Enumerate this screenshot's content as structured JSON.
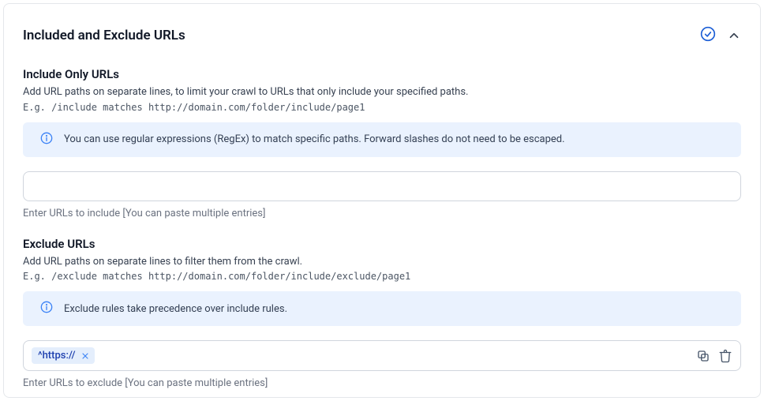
{
  "panel": {
    "title": "Included and Exclude URLs"
  },
  "include": {
    "title": "Include Only URLs",
    "desc": "Add URL paths on separate lines, to limit your crawl to URLs that only include your specified paths.",
    "example": "E.g. /include matches http://domain.com/folder/include/page1",
    "info": "You can use regular expressions (RegEx) to match specific paths. Forward slashes do not need to be escaped.",
    "input_value": "",
    "helper": "Enter URLs to include [You can paste multiple entries]"
  },
  "exclude": {
    "title": "Exclude URLs",
    "desc": "Add URL paths on separate lines to filter them from the crawl.",
    "example": "E.g. /exclude matches http://domain.com/folder/include/exclude/page1",
    "info": "Exclude rules take precedence over include rules.",
    "chip_label": "^https://",
    "input_value": "",
    "helper": "Enter URLs to exclude [You can paste multiple entries]"
  }
}
